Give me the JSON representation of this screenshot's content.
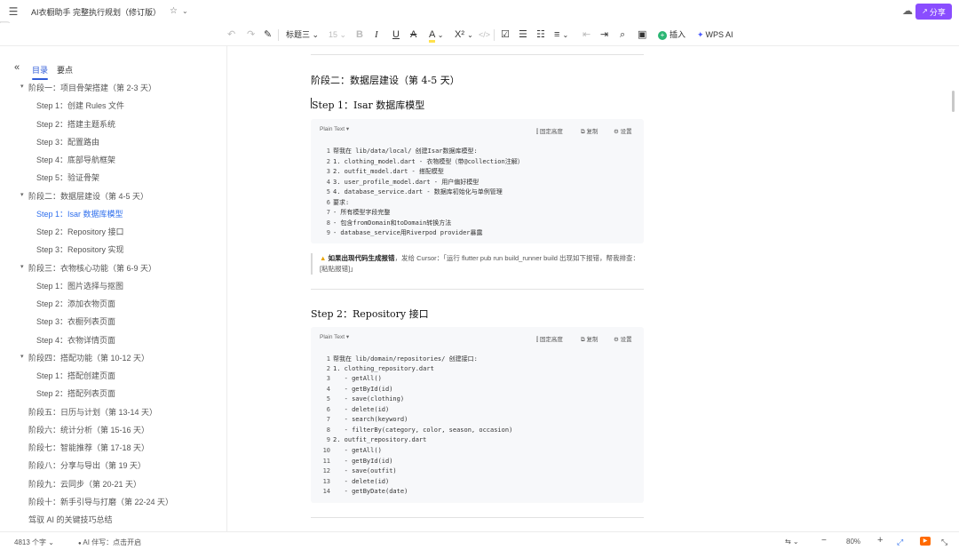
{
  "titlebar": {
    "menu_icon": "hamburger-icon",
    "title": "AI衣橱助手 完整执行规划（修订版）",
    "star_icon": "star-outline-icon",
    "chevron": "⌄",
    "cloud_icon": "cloud-sync-icon",
    "share_label": "分享"
  },
  "toolbar": {
    "style_select": "标题三",
    "font_size": "15",
    "insert_label": "插入",
    "wps_ai_label": "WPS AI"
  },
  "sidebar": {
    "tab_toc": "目录",
    "tab_points": "要点",
    "items": [
      {
        "label": "阶段一：项目骨架搭建（第 2-3 天）"
      },
      {
        "label": "Step 1：创建 Rules 文件"
      },
      {
        "label": "Step 2：搭建主题系统"
      },
      {
        "label": "Step 3：配置路由"
      },
      {
        "label": "Step 4：底部导航框架"
      },
      {
        "label": "Step 5：验证骨架"
      },
      {
        "label": "阶段二：数据层建设（第 4-5 天）"
      },
      {
        "label": "Step 1：Isar 数据库模型"
      },
      {
        "label": "Step 2：Repository 接口"
      },
      {
        "label": "Step 3：Repository 实现"
      },
      {
        "label": "阶段三：衣物核心功能（第 6-9 天）"
      },
      {
        "label": "Step 1：图片选择与抠图"
      },
      {
        "label": "Step 2：添加衣物页面"
      },
      {
        "label": "Step 3：衣橱列表页面"
      },
      {
        "label": "Step 4：衣物详情页面"
      },
      {
        "label": "阶段四：搭配功能（第 10-12 天）"
      },
      {
        "label": "Step 1：搭配创建页面"
      },
      {
        "label": "Step 2：搭配列表页面"
      },
      {
        "label": "阶段五：日历与计划（第 13-14 天）"
      },
      {
        "label": "阶段六：统计分析（第 15-16 天）"
      },
      {
        "label": "阶段七：智能推荐（第 17-18 天）"
      },
      {
        "label": "阶段八：分享与导出（第 19 天）"
      },
      {
        "label": "阶段九：云同步（第 20-21 天）"
      },
      {
        "label": "阶段十：新手引导与打磨（第 22-24 天）"
      },
      {
        "label": "驾驭 AI 的关键技巧总结"
      }
    ]
  },
  "editor": {
    "stage_heading": "阶段二：数据层建设（第 4-5 天）",
    "step1_heading": "Step 1：Isar 数据库模型",
    "step2_heading": "Step 2：Repository 接口",
    "code_lang": "Plain Text",
    "code_actions": {
      "fixed_height": "固定高度",
      "copy": "复制",
      "settings": "设置"
    },
    "code1": [
      {
        "n": "1",
        "text": "帮我在 lib/data/local/ 创建Isar数据库模型:"
      },
      {
        "n": "2",
        "text": "1. clothing_model.dart - 衣物模型（带@collection注解）"
      },
      {
        "n": "3",
        "text": "2. outfit_model.dart - 搭配模型"
      },
      {
        "n": "4",
        "text": "3. user_profile_model.dart - 用户偏好模型"
      },
      {
        "n": "5",
        "text": "4. database_service.dart - 数据库初始化与单例管理"
      },
      {
        "n": "6",
        "text": "要求:"
      },
      {
        "n": "7",
        "text": "- 所有模型字段完整"
      },
      {
        "n": "8",
        "text": "- 包含fromDomain和toDomain转换方法"
      },
      {
        "n": "9",
        "text": "- database_service用Riverpod provider暴露"
      }
    ],
    "tip_bold": "如果出现代码生成报错",
    "tip_rest": "，发给 Cursor：「运行 flutter pub run build_runner build 出现如下报错，帮我排查：[粘贴报错]」",
    "code2": [
      {
        "n": "1",
        "text": "帮我在 lib/domain/repositories/ 创建接口:"
      },
      {
        "n": "2",
        "text": "1. clothing_repository.dart"
      },
      {
        "n": "3",
        "text": "   - getAll()"
      },
      {
        "n": "4",
        "text": "   - getById(id)"
      },
      {
        "n": "5",
        "text": "   - save(clothing)"
      },
      {
        "n": "6",
        "text": "   - delete(id)"
      },
      {
        "n": "7",
        "text": "   - search(keyword)"
      },
      {
        "n": "8",
        "text": "   - filterBy(category, color, season, occasion)"
      },
      {
        "n": "9",
        "text": "2. outfit_repository.dart"
      },
      {
        "n": "10",
        "text": "   - getAll()"
      },
      {
        "n": "11",
        "text": "   - getById(id)"
      },
      {
        "n": "12",
        "text": "   - save(outfit)"
      },
      {
        "n": "13",
        "text": "   - delete(id)"
      },
      {
        "n": "14",
        "text": "   - getByDate(date)"
      }
    ]
  },
  "statusbar": {
    "word_count": "4813 个字",
    "ai_writing": "AI 伴写：点击开启",
    "zoom": "80%"
  },
  "colors": {
    "share_button": "#8a4dff",
    "accent_blue": "#2f5bd8",
    "insert_green": "#2bb673",
    "play_orange": "#ff6a00"
  }
}
